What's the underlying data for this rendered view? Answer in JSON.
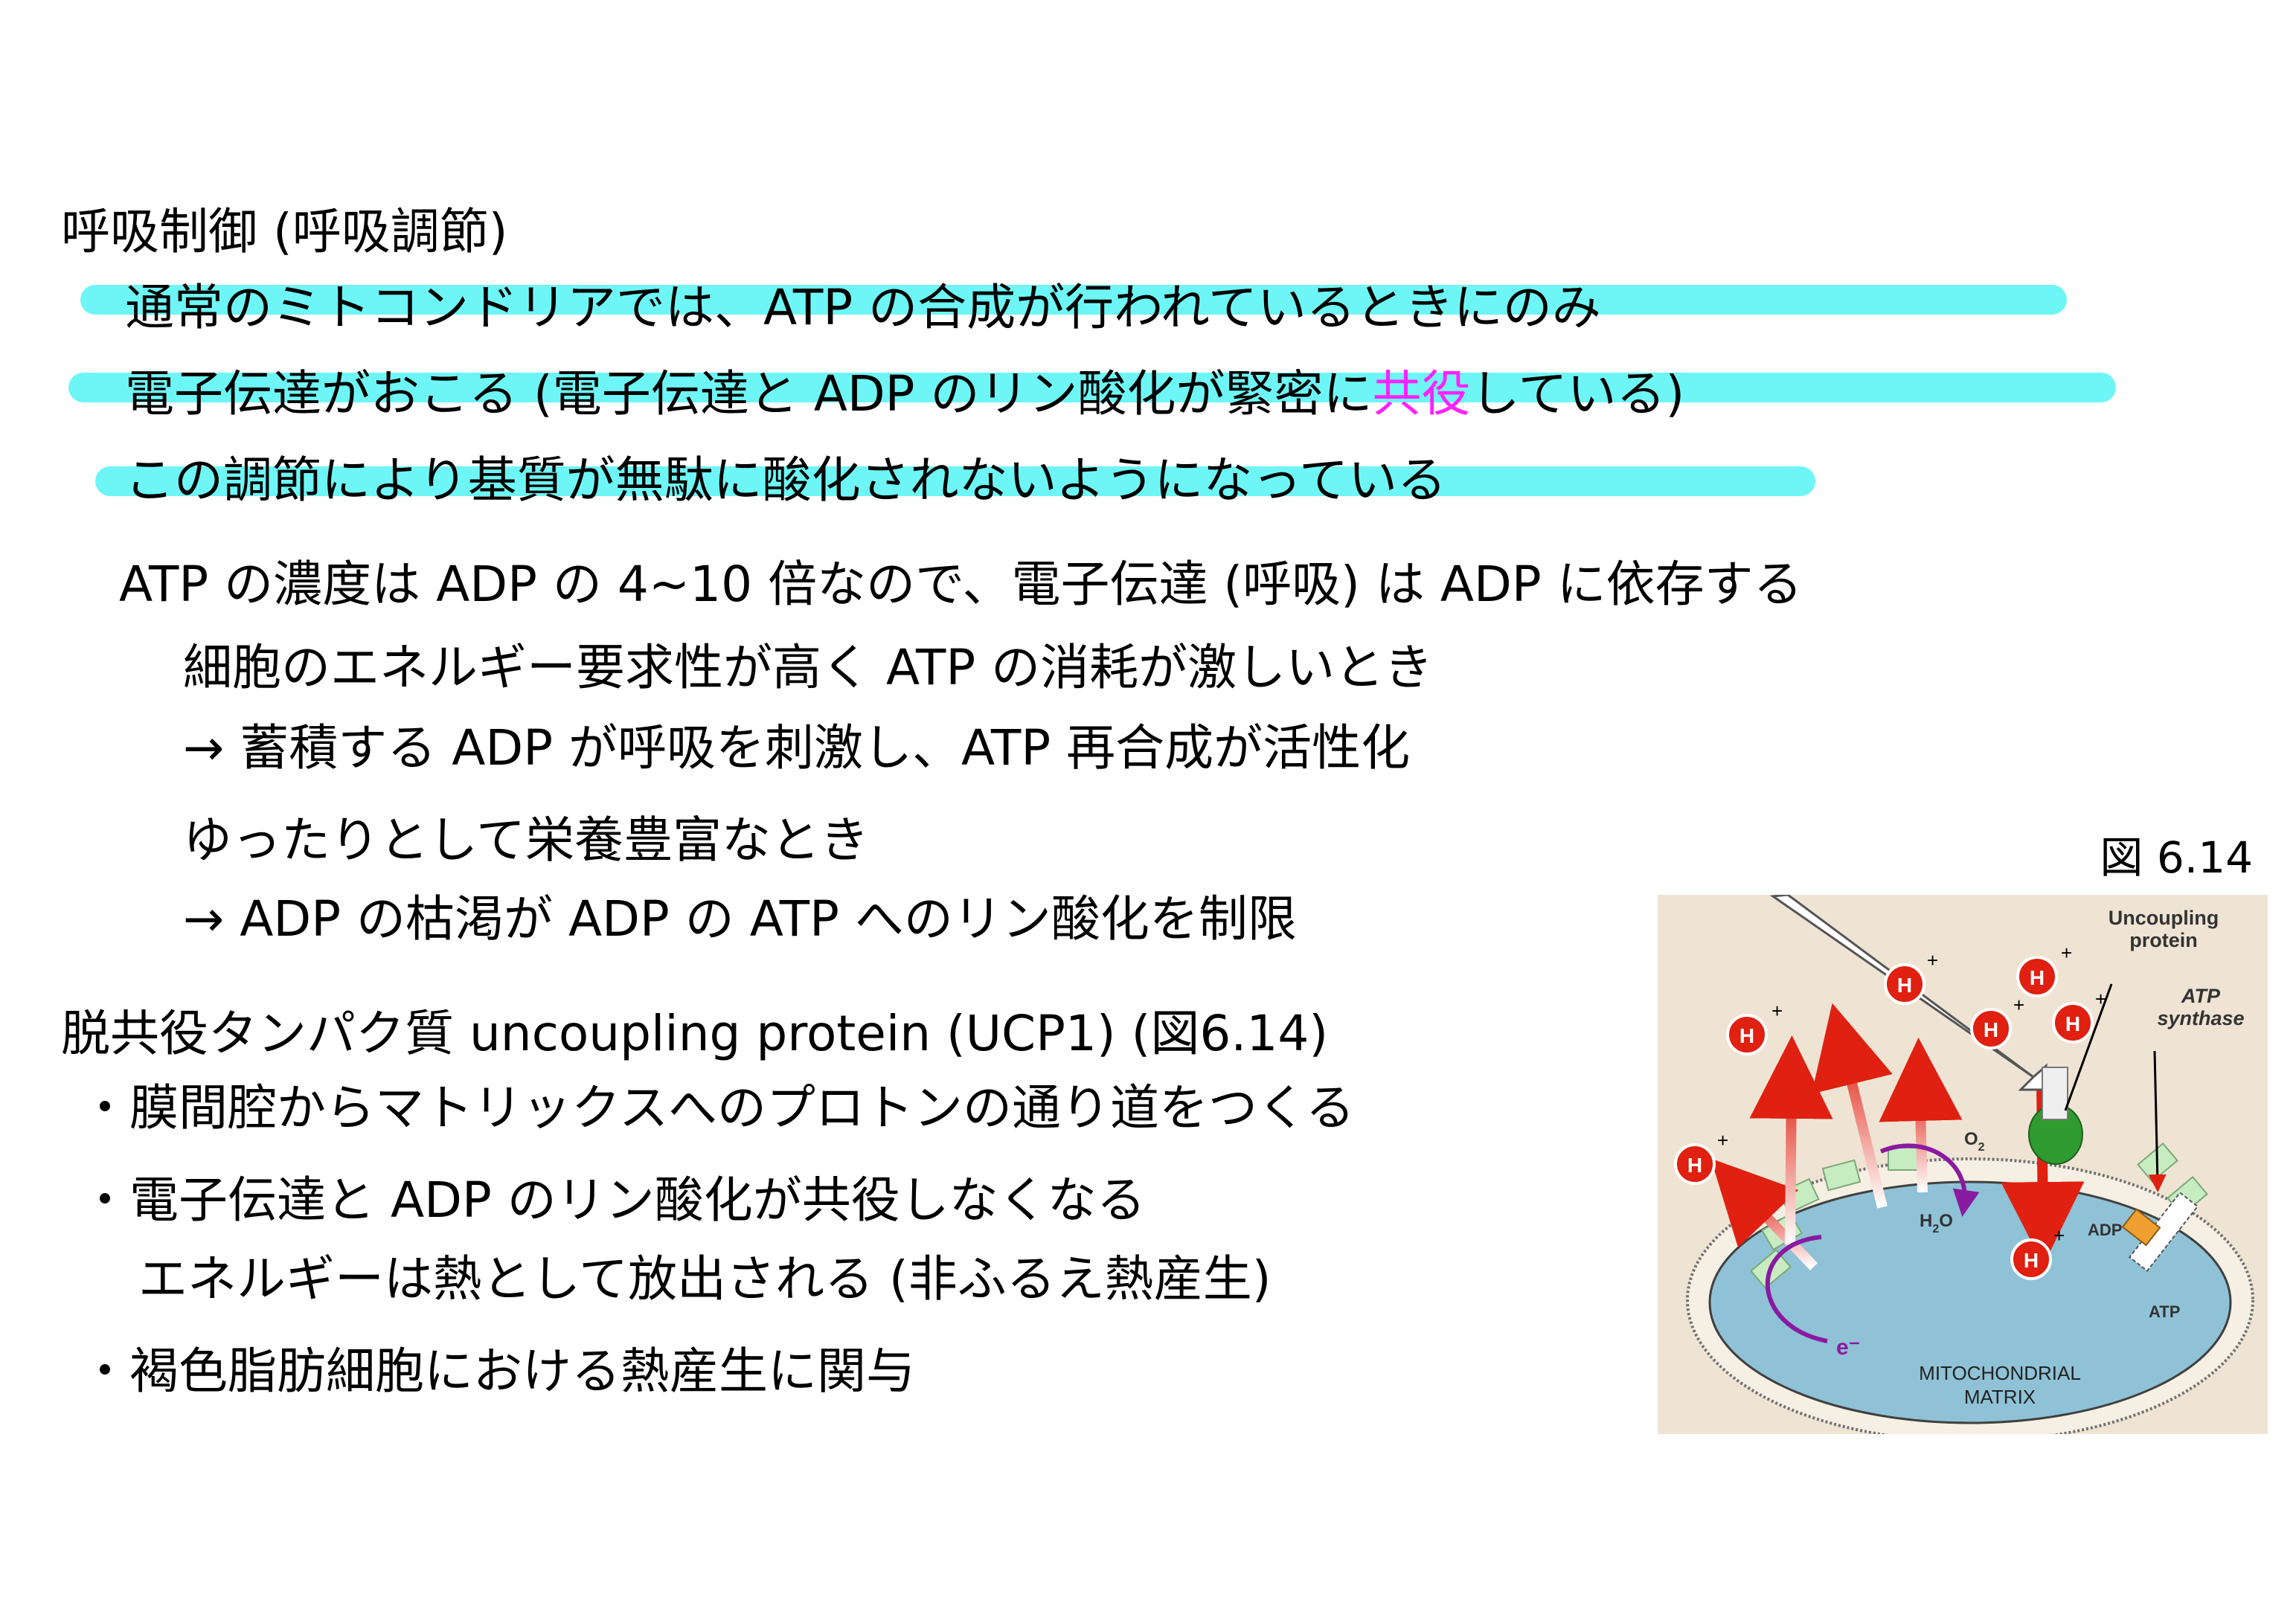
{
  "main": {
    "heading": "呼吸制御 (呼吸調節)",
    "line1": "通常のミトコンドリアでは、ATP の合成が行われているときにのみ",
    "line2_prefix": "電子伝達がおこる (電子伝達と ADP のリン酸化が緊密に",
    "line2_emph": "共役",
    "line2_suffix": "している)",
    "line3": "この調節により基質が無駄に酸化されないようになっている",
    "line4": "ATP の濃度は ADP の 4~10 倍なので、電子伝達 (呼吸) は ADP に依存する",
    "line5": "細胞のエネルギー要求性が高く ATP の消耗が激しいとき",
    "line6": "→ 蓄積する ADP が呼吸を刺激し、ATP 再合成が活性化",
    "line7": "ゆったりとして栄養豊富なとき",
    "line8": "→ ADP の枯渇が ADP の ATP へのリン酸化を制限",
    "heading2": "脱共役タンパク質 uncoupling protein (UCP1) (図6.14)",
    "bullet1": "・膜間腔からマトリックスへのプロトンの通り道をつくる",
    "bullet2": "・電子伝達と ADP のリン酸化が共役しなくなる",
    "bullet2b": "エネルギーは熱として放出される (非ふるえ熱産生)",
    "bullet3": "・褐色脂肪細胞における熱産生に関与"
  },
  "figure": {
    "caption": "図 6.14",
    "label_uncoupling_1": "Uncoupling",
    "label_uncoupling_2": "protein",
    "label_atp_1": "ATP",
    "label_atp_2": "synthase",
    "proton": "H",
    "plus": "+",
    "o2": "O",
    "o2_sub": "2",
    "h2o_h": "H",
    "h2o_sub": "2",
    "h2o_o": "O",
    "adp": "ADP",
    "atp": "ATP",
    "electron": "e⁻",
    "matrix_1": "MITOCHONDRIAL",
    "matrix_2": "MATRIX",
    "colors": {
      "highlight": "#6ef6f6",
      "emphasis": "#ff22ff",
      "figure_bg": "#efe4d4",
      "matrix": "#8fc2d6",
      "proton": "#e02010",
      "electron_path": "#8a1aa0"
    }
  }
}
